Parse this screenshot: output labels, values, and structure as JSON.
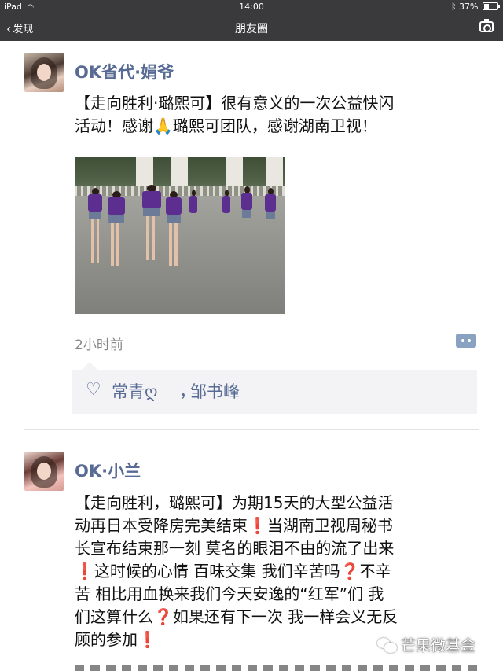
{
  "status_bar": {
    "device": "iPad",
    "time": "14:00",
    "battery_text": "37%",
    "battery_level": 0.37
  },
  "nav": {
    "back_label": "发现",
    "title": "朋友圈"
  },
  "posts": [
    {
      "author": "OK省代·娟爷",
      "content_lines": [
        "【走向胜利·璐熙可】很有意义的一次公益快闪",
        "活动！感谢🙏璐熙可团队，感谢湖南卫视！"
      ],
      "time_ago": "2小时前",
      "likes": [
        "常青ღ",
        "邹书峰"
      ],
      "like_separator": "，"
    },
    {
      "author": "OK·小兰",
      "content_lines": [
        "【走向胜利，璐熙可】为期15天的大型公益活",
        "动再日本受降房完美结束❗当湖南卫视周秘书",
        "长宣布结束那一刻 莫名的眼泪不由的流了出来",
        "❗这时候的心情  百味交集  我们辛苦吗❓不辛",
        "苦 相比用血换来我们今天安逸的“红军”们  我",
        "们这算什么❓如果还有下一次  我一样会义无反",
        "顾的参加❗"
      ]
    }
  ],
  "watermark": "芒果微基金",
  "colors": {
    "nav_bg": "#3a3a3d",
    "author_link": "#576b95",
    "likes_bg": "#f3f3f5",
    "accent_red": "#d0021b"
  },
  "icons": [
    "back-chevron-icon",
    "wifi-icon",
    "bluetooth-icon",
    "battery-icon",
    "camera-icon",
    "heart-icon",
    "comment-icon",
    "wechat-icon"
  ]
}
